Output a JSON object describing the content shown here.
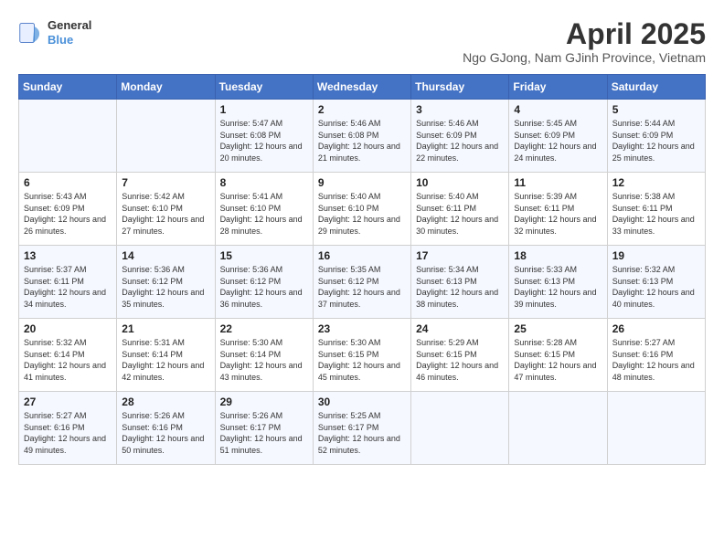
{
  "logo": {
    "line1": "General",
    "line2": "Blue"
  },
  "title": "April 2025",
  "subtitle": "Ngo GJong, Nam GJinh Province, Vietnam",
  "days_of_week": [
    "Sunday",
    "Monday",
    "Tuesday",
    "Wednesday",
    "Thursday",
    "Friday",
    "Saturday"
  ],
  "weeks": [
    [
      {
        "day": "",
        "info": ""
      },
      {
        "day": "",
        "info": ""
      },
      {
        "day": "1",
        "info": "Sunrise: 5:47 AM\nSunset: 6:08 PM\nDaylight: 12 hours and 20 minutes."
      },
      {
        "day": "2",
        "info": "Sunrise: 5:46 AM\nSunset: 6:08 PM\nDaylight: 12 hours and 21 minutes."
      },
      {
        "day": "3",
        "info": "Sunrise: 5:46 AM\nSunset: 6:09 PM\nDaylight: 12 hours and 22 minutes."
      },
      {
        "day": "4",
        "info": "Sunrise: 5:45 AM\nSunset: 6:09 PM\nDaylight: 12 hours and 24 minutes."
      },
      {
        "day": "5",
        "info": "Sunrise: 5:44 AM\nSunset: 6:09 PM\nDaylight: 12 hours and 25 minutes."
      }
    ],
    [
      {
        "day": "6",
        "info": "Sunrise: 5:43 AM\nSunset: 6:09 PM\nDaylight: 12 hours and 26 minutes."
      },
      {
        "day": "7",
        "info": "Sunrise: 5:42 AM\nSunset: 6:10 PM\nDaylight: 12 hours and 27 minutes."
      },
      {
        "day": "8",
        "info": "Sunrise: 5:41 AM\nSunset: 6:10 PM\nDaylight: 12 hours and 28 minutes."
      },
      {
        "day": "9",
        "info": "Sunrise: 5:40 AM\nSunset: 6:10 PM\nDaylight: 12 hours and 29 minutes."
      },
      {
        "day": "10",
        "info": "Sunrise: 5:40 AM\nSunset: 6:11 PM\nDaylight: 12 hours and 30 minutes."
      },
      {
        "day": "11",
        "info": "Sunrise: 5:39 AM\nSunset: 6:11 PM\nDaylight: 12 hours and 32 minutes."
      },
      {
        "day": "12",
        "info": "Sunrise: 5:38 AM\nSunset: 6:11 PM\nDaylight: 12 hours and 33 minutes."
      }
    ],
    [
      {
        "day": "13",
        "info": "Sunrise: 5:37 AM\nSunset: 6:11 PM\nDaylight: 12 hours and 34 minutes."
      },
      {
        "day": "14",
        "info": "Sunrise: 5:36 AM\nSunset: 6:12 PM\nDaylight: 12 hours and 35 minutes."
      },
      {
        "day": "15",
        "info": "Sunrise: 5:36 AM\nSunset: 6:12 PM\nDaylight: 12 hours and 36 minutes."
      },
      {
        "day": "16",
        "info": "Sunrise: 5:35 AM\nSunset: 6:12 PM\nDaylight: 12 hours and 37 minutes."
      },
      {
        "day": "17",
        "info": "Sunrise: 5:34 AM\nSunset: 6:13 PM\nDaylight: 12 hours and 38 minutes."
      },
      {
        "day": "18",
        "info": "Sunrise: 5:33 AM\nSunset: 6:13 PM\nDaylight: 12 hours and 39 minutes."
      },
      {
        "day": "19",
        "info": "Sunrise: 5:32 AM\nSunset: 6:13 PM\nDaylight: 12 hours and 40 minutes."
      }
    ],
    [
      {
        "day": "20",
        "info": "Sunrise: 5:32 AM\nSunset: 6:14 PM\nDaylight: 12 hours and 41 minutes."
      },
      {
        "day": "21",
        "info": "Sunrise: 5:31 AM\nSunset: 6:14 PM\nDaylight: 12 hours and 42 minutes."
      },
      {
        "day": "22",
        "info": "Sunrise: 5:30 AM\nSunset: 6:14 PM\nDaylight: 12 hours and 43 minutes."
      },
      {
        "day": "23",
        "info": "Sunrise: 5:30 AM\nSunset: 6:15 PM\nDaylight: 12 hours and 45 minutes."
      },
      {
        "day": "24",
        "info": "Sunrise: 5:29 AM\nSunset: 6:15 PM\nDaylight: 12 hours and 46 minutes."
      },
      {
        "day": "25",
        "info": "Sunrise: 5:28 AM\nSunset: 6:15 PM\nDaylight: 12 hours and 47 minutes."
      },
      {
        "day": "26",
        "info": "Sunrise: 5:27 AM\nSunset: 6:16 PM\nDaylight: 12 hours and 48 minutes."
      }
    ],
    [
      {
        "day": "27",
        "info": "Sunrise: 5:27 AM\nSunset: 6:16 PM\nDaylight: 12 hours and 49 minutes."
      },
      {
        "day": "28",
        "info": "Sunrise: 5:26 AM\nSunset: 6:16 PM\nDaylight: 12 hours and 50 minutes."
      },
      {
        "day": "29",
        "info": "Sunrise: 5:26 AM\nSunset: 6:17 PM\nDaylight: 12 hours and 51 minutes."
      },
      {
        "day": "30",
        "info": "Sunrise: 5:25 AM\nSunset: 6:17 PM\nDaylight: 12 hours and 52 minutes."
      },
      {
        "day": "",
        "info": ""
      },
      {
        "day": "",
        "info": ""
      },
      {
        "day": "",
        "info": ""
      }
    ]
  ]
}
